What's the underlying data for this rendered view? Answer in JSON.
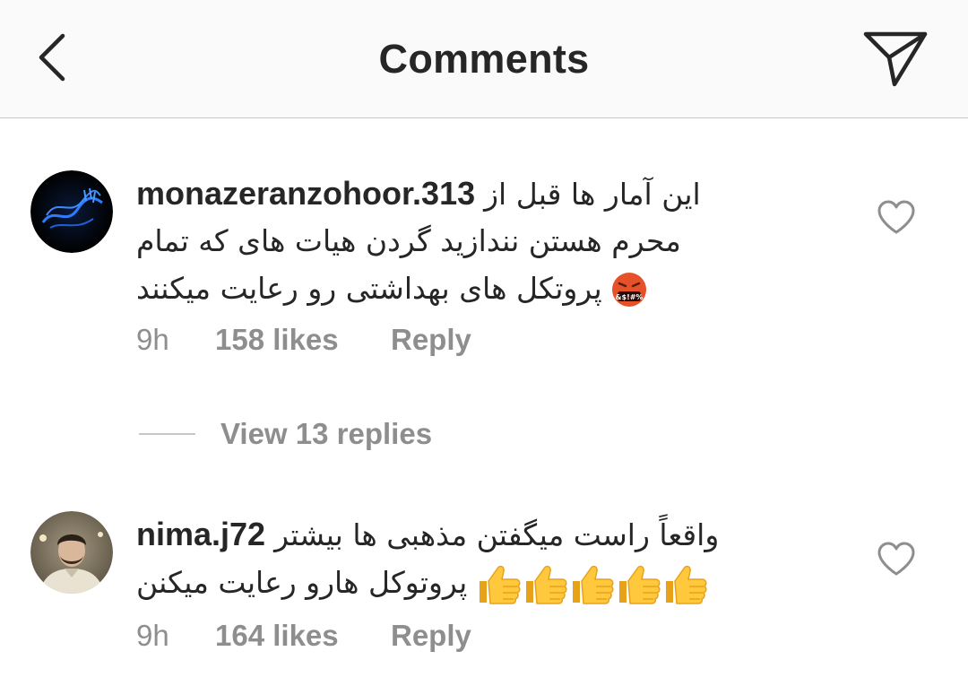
{
  "header": {
    "back_icon": "chevron-left-icon",
    "title": "Comments",
    "send_icon": "paper-plane-icon"
  },
  "comments": [
    {
      "username": "monazeranzohoor.313",
      "text_line1": "این آمار ها قبل از",
      "text_line2": "محرم هستن نندازید گردن هیات های که تمام",
      "text_line3": "پروتکل های بهداشتی رو رعایت میکنند",
      "emoji": "angry-cursing-face-emoji",
      "time": "9h",
      "likes": "158 likes",
      "reply": "Reply",
      "view_replies": "View 13 replies"
    },
    {
      "username": "nima.j72",
      "text_line1": "واقعاً راست میگفتن مذهبی ها بیشتر",
      "text_line2": "پروتوکل هارو رعایت میکنن",
      "emoji": "thumbs-up-emoji",
      "emoji_count": 5,
      "time": "9h",
      "likes": "164 likes",
      "reply": "Reply"
    }
  ],
  "colors": {
    "header_bg": "#fafafa",
    "text": "#262626",
    "secondary": "#8e8e8e",
    "divider": "#c7c7c7"
  }
}
